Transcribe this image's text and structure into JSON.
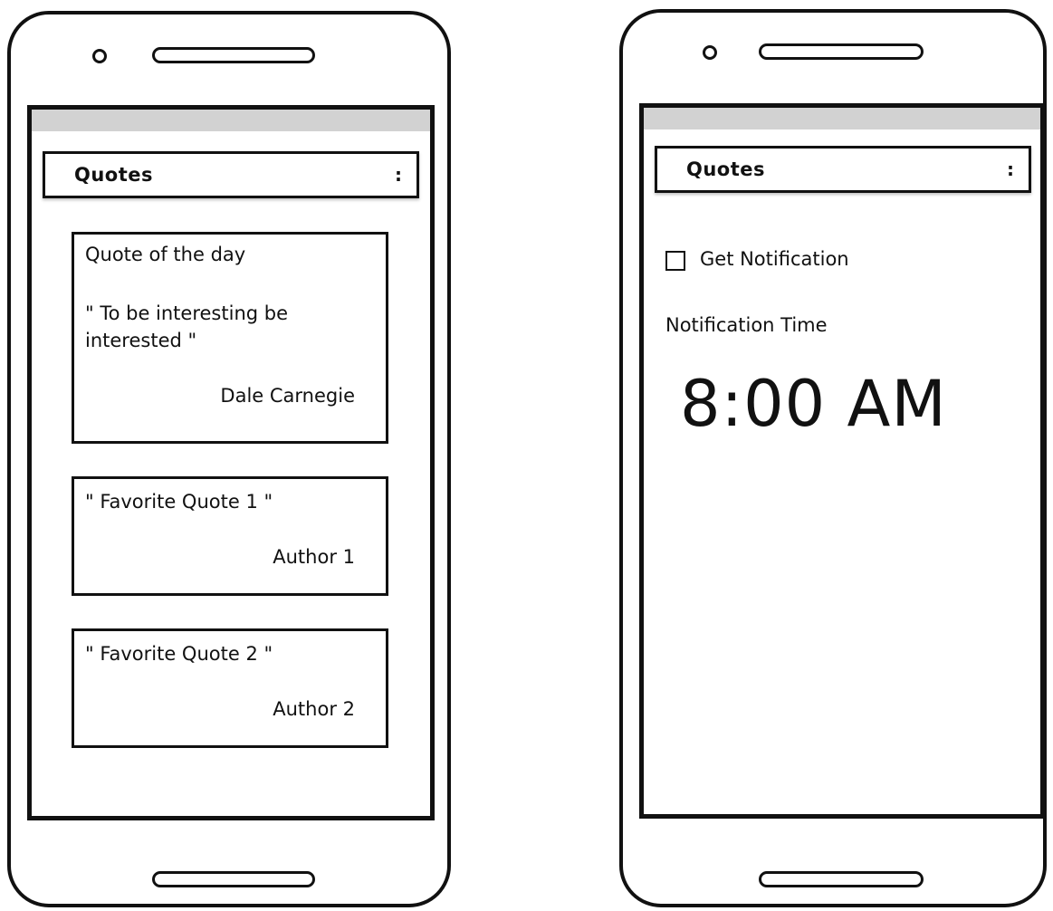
{
  "left_screen": {
    "app_title": "Quotes",
    "menu_label": ":",
    "quote_of_the_day": {
      "heading": "Quote of the day",
      "text": "\" To be interesting be interested \"",
      "author": "Dale Carnegie"
    },
    "favorites": [
      {
        "text": "\" Favorite Quote 1 \"",
        "author": "Author 1"
      },
      {
        "text": "\" Favorite Quote 2 \"",
        "author": "Author 2"
      }
    ]
  },
  "right_screen": {
    "app_title": "Quotes",
    "menu_label": ":",
    "notification_checkbox_label": "Get Notification",
    "notification_checked": false,
    "notification_time_label": "Notification Time",
    "notification_time": "8:00 AM"
  }
}
